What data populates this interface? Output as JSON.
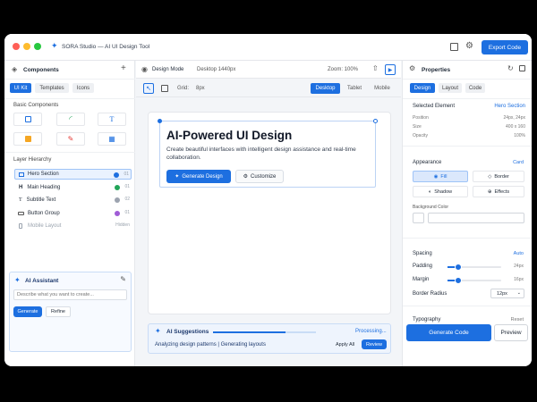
{
  "titlebar": {
    "title": "SORA Studio — AI UI Design Tool",
    "export_label": "Export Code"
  },
  "toolbar": {
    "mode": "Design Mode",
    "device": "Desktop 1440px",
    "zoom": "Zoom: 100%",
    "grid_label": "Grid:",
    "grid_value": "8px",
    "views": [
      "Desktop",
      "Tablet",
      "Mobile"
    ]
  },
  "left": {
    "components_title": "Components",
    "tabs": [
      "UI Kit",
      "Templates",
      "Icons"
    ],
    "basic_title": "Basic Components",
    "layer_title": "Layer Hierarchy",
    "layers": [
      {
        "name": "Hero Section",
        "color": "#1d6fe0",
        "num": "01"
      },
      {
        "name": "Main Heading",
        "color": "#22a559",
        "num": "01"
      },
      {
        "name": "Subtitle Text",
        "color": "#9ca3af",
        "num": "02"
      },
      {
        "name": "Button Group",
        "color": "#a05cd6",
        "num": "01"
      },
      {
        "name": "Mobile Layout",
        "color": "",
        "num": "Hidden"
      }
    ],
    "ai": {
      "title": "AI Assistant",
      "placeholder": "Describe what you want to create...",
      "generate": "Generate",
      "refine": "Refine"
    }
  },
  "canvas": {
    "heading": "AI-Powered UI Design",
    "sub": "Create beautiful interfaces with intelligent design assistance and real-time collaboration.",
    "primary": "Generate Design",
    "secondary": "Customize"
  },
  "suggest": {
    "title": "AI Suggestions",
    "status": "Processing...",
    "line": "Analyzing design patterns | Generating layouts",
    "apply": "Apply All",
    "review": "Review",
    "progress": 0.7
  },
  "right": {
    "title": "Properties",
    "tabs": [
      "Design",
      "Layout",
      "Code"
    ],
    "selected_label": "Selected Element",
    "selected_value": "Hero Section",
    "props": [
      {
        "k": "Position",
        "v": "24px, 24px"
      },
      {
        "k": "Size",
        "v": "400 x 160"
      },
      {
        "k": "Opacity",
        "v": "100%"
      }
    ],
    "appearance_title": "Appearance",
    "appearance_link": "Card",
    "fill": "Fill",
    "border": "Border",
    "shadow": "Shadow",
    "effects": "Effects",
    "bg_label": "Background Color",
    "spacing_title": "Spacing",
    "spacing_link": "Auto",
    "padding_label": "Padding",
    "padding_value": "24px",
    "padding_level": 0.2,
    "margin_label": "Margin",
    "margin_value": "16px",
    "margin_level": 0.2,
    "radius_label": "Border Radius",
    "radius_value": "12px",
    "typo_title": "Typography",
    "typo_link": "Reset",
    "gen_code": "Generate Code",
    "preview": "Preview"
  }
}
